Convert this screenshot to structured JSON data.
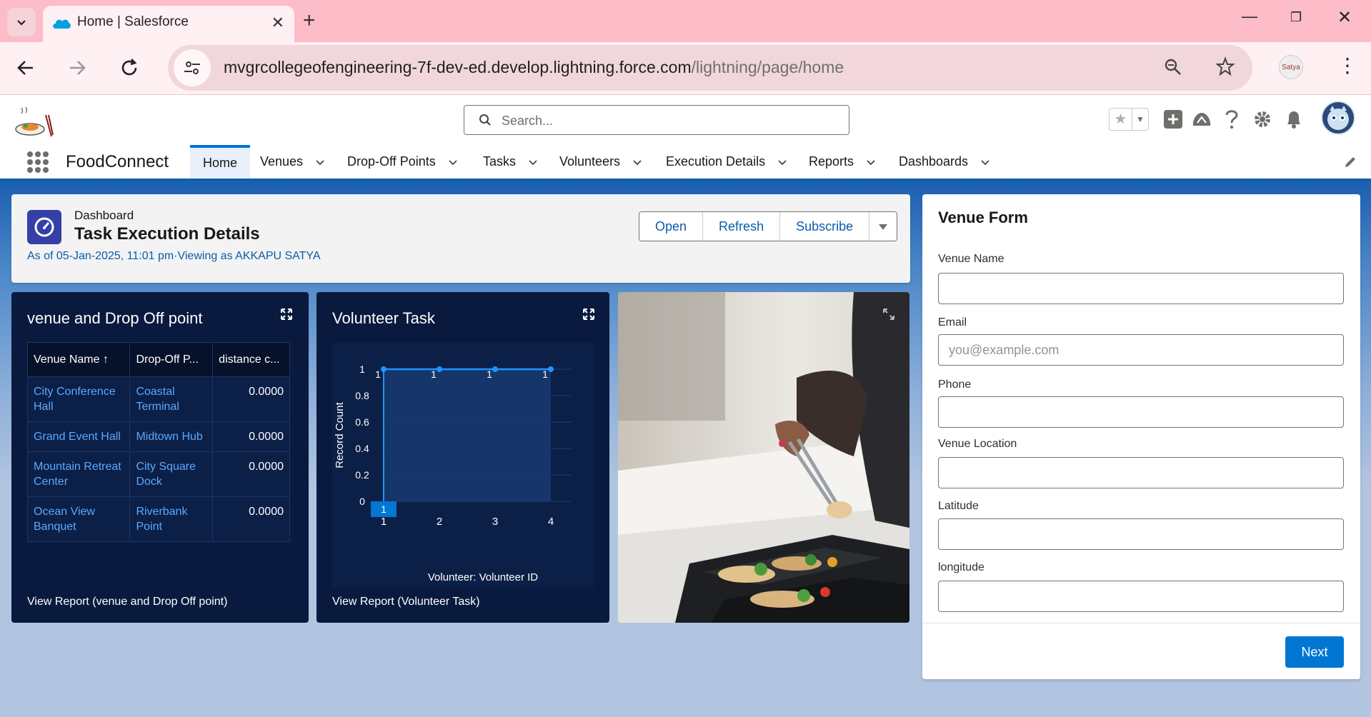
{
  "browser": {
    "tab_title": "Home | Salesforce",
    "url_host": "mvgrcollegeofengineering-7f-dev-ed.develop.lightning.force.com",
    "url_path": "/lightning/page/home",
    "profile_chip_text": "Satya"
  },
  "header": {
    "search_placeholder": "Search..."
  },
  "nav": {
    "app_name": "FoodConnect",
    "items": [
      {
        "label": "Home"
      },
      {
        "label": "Venues"
      },
      {
        "label": "Drop-Off Points"
      },
      {
        "label": "Tasks"
      },
      {
        "label": "Volunteers"
      },
      {
        "label": "Execution Details"
      },
      {
        "label": "Reports"
      },
      {
        "label": "Dashboards"
      }
    ]
  },
  "dashboard": {
    "eyebrow": "Dashboard",
    "title": "Task Execution Details",
    "subtitle": "As of 05-Jan-2025, 11:01 pm·Viewing as AKKAPU SATYA",
    "buttons": {
      "open": "Open",
      "refresh": "Refresh",
      "subscribe": "Subscribe"
    }
  },
  "widget_table": {
    "title": "venue and Drop Off point",
    "columns": [
      "Venue Name ↑",
      "Drop-Off P...",
      "distance c..."
    ],
    "rows": [
      [
        "City Conference Hall",
        "Coastal Terminal",
        "0.0000"
      ],
      [
        "Grand Event Hall",
        "Midtown Hub",
        "0.0000"
      ],
      [
        "Mountain Retreat Center",
        "City Square Dock",
        "0.0000"
      ],
      [
        "Ocean View Banquet",
        "Riverbank Point",
        "0.0000"
      ]
    ],
    "footer": "View Report (venue and Drop Off point)"
  },
  "widget_chart": {
    "title": "Volunteer Task",
    "footer": "View Report (Volunteer Task)"
  },
  "chart_data": {
    "type": "area",
    "x": [
      1,
      2,
      3,
      4
    ],
    "values": [
      1,
      1,
      1,
      1
    ],
    "data_labels": [
      "1",
      "1",
      "1",
      "1"
    ],
    "xlabel": "Volunteer: Volunteer ID",
    "ylabel": "Record Count",
    "ylim": [
      0,
      1
    ],
    "yticks": [
      "0",
      "0.2",
      "0.4",
      "0.6",
      "0.8",
      "1"
    ],
    "xticks": [
      "1",
      "2",
      "3",
      "4"
    ],
    "highlighted_x": "1",
    "grid": true,
    "colors": {
      "line": "#1b96ff",
      "fill": "#17386e"
    }
  },
  "venue_form": {
    "title": "Venue Form",
    "fields": [
      {
        "label": "Venue Name",
        "placeholder": ""
      },
      {
        "label": "Email",
        "placeholder": "you@example.com"
      },
      {
        "label": "Phone",
        "placeholder": ""
      },
      {
        "label": "Venue Location",
        "placeholder": ""
      },
      {
        "label": "Latitude",
        "placeholder": ""
      },
      {
        "label": "longitude",
        "placeholder": ""
      }
    ],
    "next_label": "Next"
  },
  "colors": {
    "brand_blue": "#0176d3",
    "link_blue": "#0b5cab",
    "widget_bg": "#0a1a3e",
    "browser_tabbar": "#fcbcc8"
  }
}
